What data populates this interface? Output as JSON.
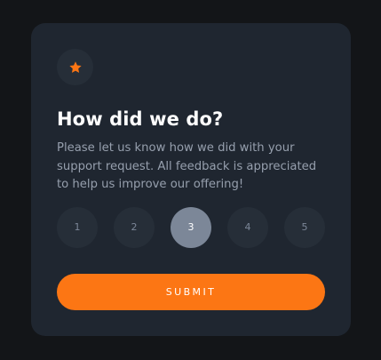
{
  "card": {
    "icon": "star-icon",
    "title": "How did we do?",
    "description": "Please let us know how we did with your support request. All feedback is appreciated to help us improve our offering!",
    "ratings": [
      {
        "label": "1",
        "selected": false
      },
      {
        "label": "2",
        "selected": false
      },
      {
        "label": "3",
        "selected": true
      },
      {
        "label": "4",
        "selected": false
      },
      {
        "label": "5",
        "selected": false
      }
    ],
    "submit_label": "SUBMIT"
  },
  "colors": {
    "page_background": "#131518",
    "card_background": "#1f2630",
    "badge_background": "#262e38",
    "rating_background": "#262e38",
    "rating_selected_background": "#7c8798",
    "text_primary": "#ffffff",
    "text_secondary": "#969fad",
    "accent": "#fc7614"
  }
}
